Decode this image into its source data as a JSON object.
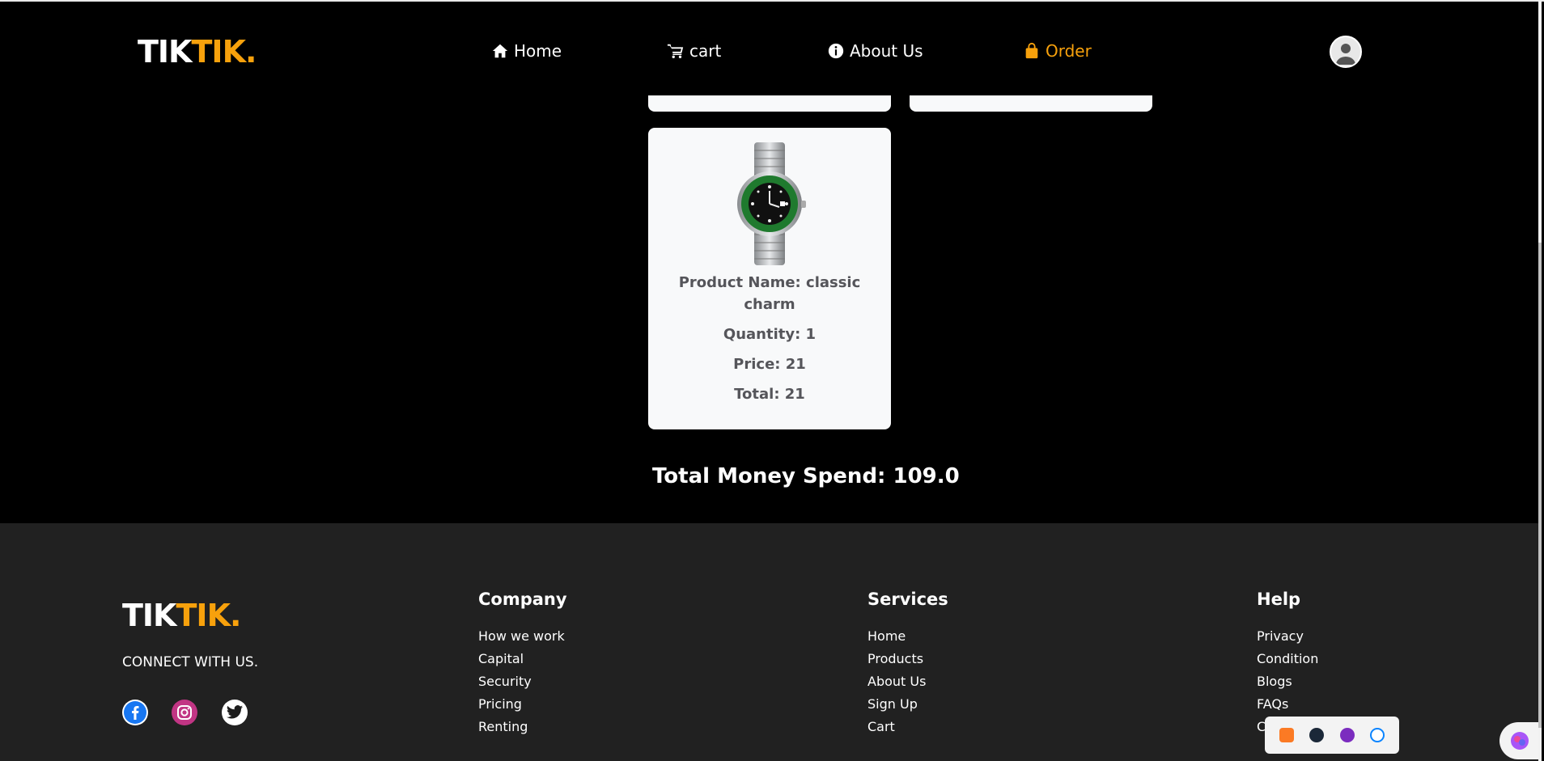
{
  "brand": {
    "part1": "TIK",
    "part2": "TIK."
  },
  "nav": {
    "items": [
      {
        "label": "Home",
        "icon": "home-icon"
      },
      {
        "label": "cart",
        "icon": "cart-icon"
      },
      {
        "label": "About Us",
        "icon": "info-icon"
      },
      {
        "label": "Order",
        "icon": "bag-icon",
        "active": true
      }
    ],
    "avatar_icon": "user-icon"
  },
  "order_item": {
    "image": "watch-image",
    "name_line": "Product Name: classic charm",
    "quantity_line": "Quantity: 1",
    "price_line": "Price: 21",
    "total_line": "Total: 21"
  },
  "total_spend": "Total Money Spend: 109.0",
  "footer": {
    "connect": "CONNECT WITH US.",
    "social": [
      "facebook-icon",
      "instagram-icon",
      "twitter-icon"
    ],
    "company": {
      "title": "Company",
      "links": [
        "How we work",
        "Capital",
        "Security",
        "Pricing",
        "Renting"
      ]
    },
    "services": {
      "title": "Services",
      "links": [
        "Home",
        "Products",
        "About Us",
        "Sign Up",
        "Cart"
      ]
    },
    "help": {
      "title": "Help",
      "links": [
        "Privacy",
        "Condition",
        "Blogs",
        "FAQs",
        "C"
      ]
    }
  },
  "colors": {
    "accent": "#f7a10c",
    "background": "#000000",
    "footer": "#212121",
    "card": "#f8f9fa",
    "card_text": "#55555a"
  }
}
